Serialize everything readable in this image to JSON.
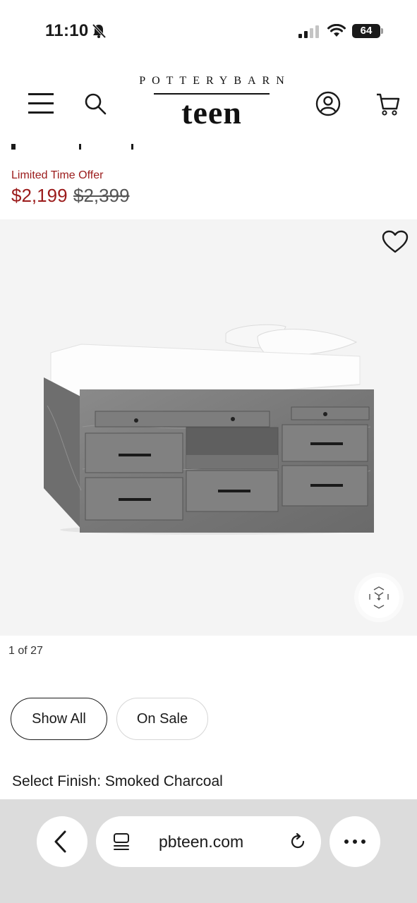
{
  "status_bar": {
    "time": "11:10",
    "battery": "64"
  },
  "header": {
    "logo_top": "POTTERYBARN",
    "logo_main": "teen"
  },
  "product": {
    "offer_label": "Limited Time Offer",
    "sale_price": "$2,199",
    "original_price": "$2,399",
    "image_counter": "1 of 27"
  },
  "filters": {
    "show_all": "Show All",
    "on_sale": "On Sale"
  },
  "finish": {
    "label": "Select Finish: ",
    "value": "Smoked Charcoal"
  },
  "browser": {
    "url": "pbteen.com"
  },
  "colors": {
    "sale_red": "#9b1b1b",
    "panel_bg": "#f4f4f4",
    "browser_bar": "#dcdcdc"
  },
  "icons": [
    "notifications-off-icon",
    "cellular-signal-icon",
    "wifi-icon",
    "battery-icon",
    "menu-icon",
    "search-icon",
    "account-icon",
    "cart-icon",
    "heart-icon",
    "ar-view-icon",
    "back-icon",
    "tabs-icon",
    "reload-icon",
    "more-icon"
  ]
}
